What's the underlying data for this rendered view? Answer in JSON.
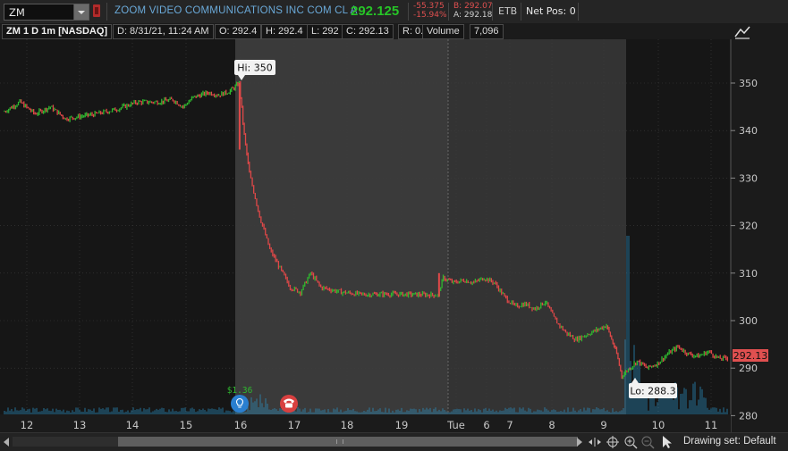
{
  "header": {
    "symbol": "ZM",
    "company": "ZOOM VIDEO COMMUNICATIONS INC COM CL A",
    "last": "292.125",
    "net_change": "-55.375",
    "pct_change": "-15.94%",
    "bid": "B: 292.07",
    "ask": "A: 292.18",
    "etb": "ETB",
    "net_pos": "Net Pos: 0"
  },
  "info_row": {
    "title": "ZM 1 D 1m [NASDAQ]",
    "date": "D: 8/31/21, 11:24 AM",
    "open": "O: 292.4",
    "high": "H: 292.4",
    "low": "L: 292",
    "close": "C: 292.13",
    "range": "R: 0.4",
    "volume_label": "Volume",
    "volume": "7,096"
  },
  "chart": {
    "hi_label": "Hi: 350",
    "lo_label": "Lo: 288.3",
    "last_label": "292.13",
    "earnings_label": "$1.36",
    "colors": {
      "up": "#2fb82f",
      "down": "#e04848",
      "volume": "#2a8fc0",
      "last_tag": "#e05050"
    }
  },
  "chart_data": {
    "type": "candlestick",
    "x_ticks": [
      "12",
      "13",
      "14",
      "15",
      "16",
      "17",
      "18",
      "19",
      "Tue",
      "6",
      "7",
      "8",
      "9",
      "10",
      "11"
    ],
    "y_ticks": [
      280,
      290,
      300,
      310,
      320,
      330,
      340,
      350
    ],
    "ylim": [
      279,
      358
    ],
    "grid": true,
    "series": [
      {
        "name": "Price",
        "points": [
          [
            0,
            344
          ],
          [
            3,
            346
          ],
          [
            6,
            343.5
          ],
          [
            9,
            345
          ],
          [
            12,
            342.5
          ],
          [
            15,
            343
          ],
          [
            18,
            343.5
          ],
          [
            22,
            344.5
          ],
          [
            26,
            346
          ],
          [
            30,
            346
          ],
          [
            33,
            346.5
          ],
          [
            35,
            345
          ],
          [
            37,
            347
          ],
          [
            40,
            348
          ],
          [
            42,
            347.5
          ],
          [
            44,
            348.2
          ],
          [
            45,
            349
          ],
          [
            46,
            350
          ],
          [
            47,
            339
          ],
          [
            48,
            331
          ],
          [
            50,
            322
          ],
          [
            52,
            315
          ],
          [
            54,
            311
          ],
          [
            56,
            307
          ],
          [
            58,
            306
          ],
          [
            60,
            310
          ],
          [
            62,
            307
          ],
          [
            64,
            306.5
          ],
          [
            66,
            306
          ],
          [
            70,
            305.5
          ],
          [
            75,
            305.6
          ],
          [
            80,
            305.5
          ],
          [
            85,
            305.4
          ],
          [
            86,
            309
          ],
          [
            88,
            308
          ],
          [
            90,
            308.5
          ],
          [
            92,
            308
          ],
          [
            94,
            309
          ],
          [
            96,
            308
          ],
          [
            98,
            305
          ],
          [
            100,
            303
          ],
          [
            102,
            303.5
          ],
          [
            104,
            302.5
          ],
          [
            106,
            304
          ],
          [
            108,
            300
          ],
          [
            110,
            297.5
          ],
          [
            112,
            296
          ],
          [
            114,
            297
          ],
          [
            116,
            298
          ],
          [
            118,
            299
          ],
          [
            119,
            296
          ],
          [
            120,
            293
          ],
          [
            121,
            288.3
          ],
          [
            122,
            289.5
          ],
          [
            124,
            291.5
          ],
          [
            126,
            290
          ],
          [
            128,
            291
          ],
          [
            130,
            293
          ],
          [
            132,
            294.5
          ],
          [
            134,
            293
          ],
          [
            136,
            292.5
          ],
          [
            138,
            293.5
          ],
          [
            140,
            292
          ],
          [
            142,
            292.13
          ]
        ]
      }
    ],
    "annotations": {
      "hi": 350,
      "lo": 288.3,
      "last": 292.13
    }
  },
  "footer": {
    "drawing_set": "Drawing set: Default"
  }
}
